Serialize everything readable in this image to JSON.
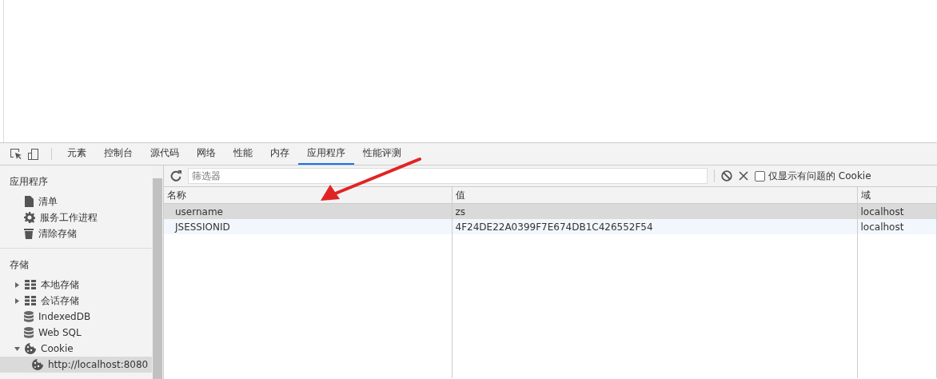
{
  "toolbar": {
    "tabs": [
      {
        "label": "元素",
        "selected": false
      },
      {
        "label": "控制台",
        "selected": false
      },
      {
        "label": "源代码",
        "selected": false
      },
      {
        "label": "网络",
        "selected": false
      },
      {
        "label": "性能",
        "selected": false
      },
      {
        "label": "内存",
        "selected": false
      },
      {
        "label": "应用程序",
        "selected": true
      },
      {
        "label": "性能评测",
        "selected": false
      }
    ]
  },
  "sidebar": {
    "sections": [
      {
        "title": "应用程序",
        "items": [
          {
            "label": "清单",
            "kind": "file",
            "selected": false
          },
          {
            "label": "服务工作进程",
            "kind": "gear",
            "selected": false
          },
          {
            "label": "清除存储",
            "kind": "trash",
            "selected": false
          }
        ]
      },
      {
        "title": "存储",
        "items": [
          {
            "label": "本地存储",
            "kind": "grid",
            "expanded": false,
            "selected": false
          },
          {
            "label": "会话存储",
            "kind": "grid",
            "expanded": false,
            "selected": false
          },
          {
            "label": "IndexedDB",
            "kind": "db",
            "selected": false
          },
          {
            "label": "Web SQL",
            "kind": "db",
            "selected": false
          },
          {
            "label": "Cookie",
            "kind": "cookie",
            "expanded": true,
            "selected": false,
            "children": [
              {
                "label": "http://localhost:8080",
                "kind": "cookie",
                "selected": true
              }
            ]
          }
        ]
      }
    ]
  },
  "filter_bar": {
    "placeholder": "筛选器",
    "issues_only": {
      "label": "仅显示有问题的 Cookie",
      "checked": false
    }
  },
  "table": {
    "columns": [
      "名称",
      "值",
      "域"
    ],
    "rows": [
      {
        "cells": [
          "username",
          "zs",
          "localhost"
        ],
        "selected": true
      },
      {
        "cells": [
          "JSESSIONID",
          "4F24DE22A0399F7E674DB1C426552F54",
          "localhost"
        ],
        "selected": false
      }
    ]
  }
}
